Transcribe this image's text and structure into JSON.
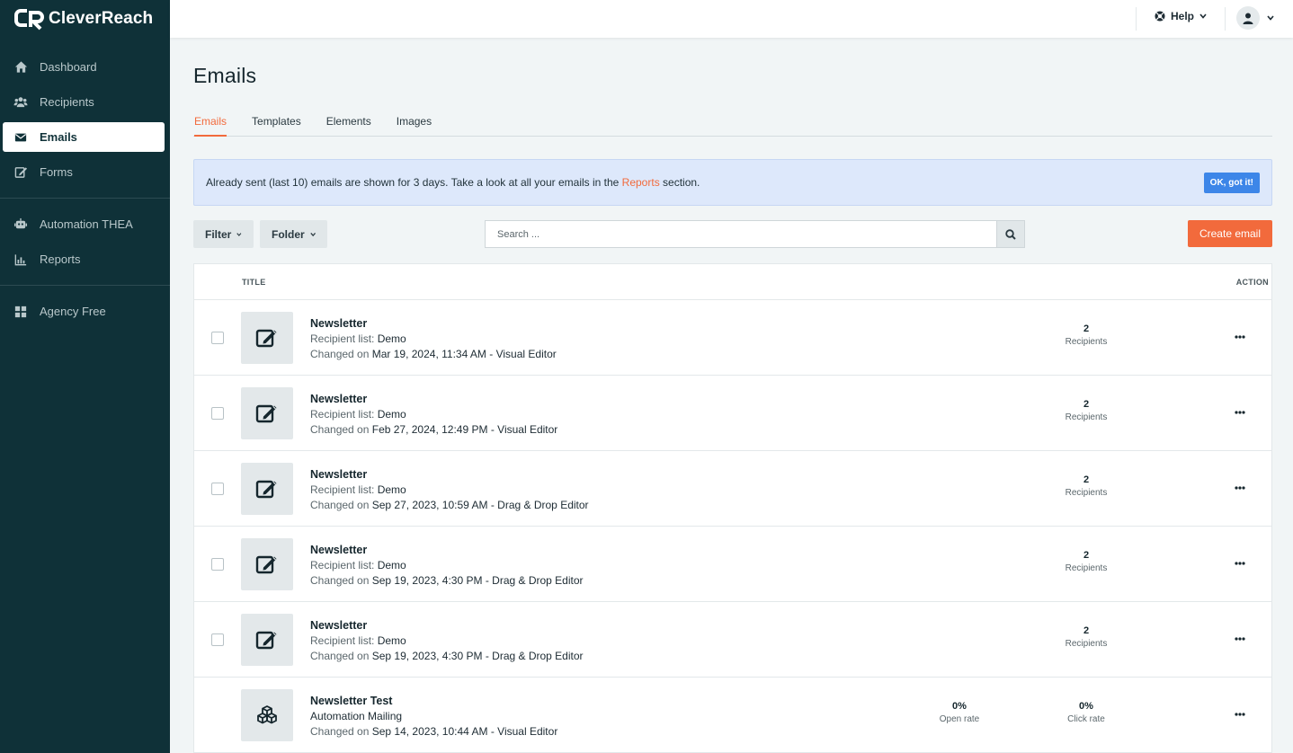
{
  "app": {
    "brand": "CleverReach",
    "colors": {
      "sidebar": "#0f3138",
      "accent": "#f26a3c",
      "info_bg": "#dde8fb",
      "ok_button": "#3d86e8"
    }
  },
  "sidebar": {
    "groups": [
      [
        {
          "label": "Dashboard",
          "icon": "home-icon"
        },
        {
          "label": "Recipients",
          "icon": "users-icon"
        },
        {
          "label": "Emails",
          "icon": "envelope-icon",
          "active": true
        },
        {
          "label": "Forms",
          "icon": "edit-form-icon"
        }
      ],
      [
        {
          "label": "Automation THEA",
          "icon": "robot-icon"
        },
        {
          "label": "Reports",
          "icon": "bar-chart-icon"
        }
      ],
      [
        {
          "label": "Agency Free",
          "icon": "grid-icon"
        }
      ]
    ]
  },
  "topbar": {
    "help_label": "Help",
    "help_icon": "help-circle-icon",
    "user_icon": "user-icon"
  },
  "page": {
    "title": "Emails"
  },
  "tabs": [
    {
      "label": "Emails",
      "active": true
    },
    {
      "label": "Templates"
    },
    {
      "label": "Elements"
    },
    {
      "label": "Images"
    }
  ],
  "notice": {
    "text_before": "Already sent (last 10) emails are shown for 3 days. Take a look at all your emails in the ",
    "link": "Reports",
    "text_after": " section.",
    "button": "OK, got it!"
  },
  "toolbar": {
    "filter_label": "Filter",
    "folder_label": "Folder",
    "search_placeholder": "Search ...",
    "create_label": "Create email"
  },
  "table": {
    "col_title": "TITLE",
    "col_action": "ACTION",
    "rows": [
      {
        "name": "Newsletter",
        "line2_label": "Recipient list:",
        "line2_value": "Demo",
        "changed_label": "Changed on",
        "changed_value": "Mar 19, 2024, 11:34 AM - Visual Editor",
        "icon": "edit-icon",
        "checkbox": true,
        "stats": [
          {
            "num": "2",
            "sub": "Recipients"
          }
        ]
      },
      {
        "name": "Newsletter",
        "line2_label": "Recipient list:",
        "line2_value": "Demo",
        "changed_label": "Changed on",
        "changed_value": "Feb 27, 2024, 12:49 PM - Visual Editor",
        "icon": "edit-icon",
        "checkbox": true,
        "stats": [
          {
            "num": "2",
            "sub": "Recipients"
          }
        ]
      },
      {
        "name": "Newsletter",
        "line2_label": "Recipient list:",
        "line2_value": "Demo",
        "changed_label": "Changed on",
        "changed_value": "Sep 27, 2023, 10:59 AM - Drag & Drop Editor",
        "icon": "edit-icon",
        "checkbox": true,
        "stats": [
          {
            "num": "2",
            "sub": "Recipients"
          }
        ]
      },
      {
        "name": "Newsletter",
        "line2_label": "Recipient list:",
        "line2_value": "Demo",
        "changed_label": "Changed on",
        "changed_value": "Sep 19, 2023, 4:30 PM - Drag & Drop Editor",
        "icon": "edit-icon",
        "checkbox": true,
        "stats": [
          {
            "num": "2",
            "sub": "Recipients"
          }
        ]
      },
      {
        "name": "Newsletter",
        "line2_label": "Recipient list:",
        "line2_value": "Demo",
        "changed_label": "Changed on",
        "changed_value": "Sep 19, 2023, 4:30 PM - Drag & Drop Editor",
        "icon": "edit-icon",
        "checkbox": true,
        "stats": [
          {
            "num": "2",
            "sub": "Recipients"
          }
        ]
      },
      {
        "name": "Newsletter Test",
        "line2_label": "",
        "line2_value": "Automation Mailing",
        "changed_label": "Changed on",
        "changed_value": "Sep 14, 2023, 10:44 AM - Visual Editor",
        "icon": "cubes-icon",
        "checkbox": false,
        "stats": [
          {
            "num": "0%",
            "sub": "Open rate"
          },
          {
            "num": "0%",
            "sub": "Click rate"
          }
        ]
      }
    ]
  }
}
